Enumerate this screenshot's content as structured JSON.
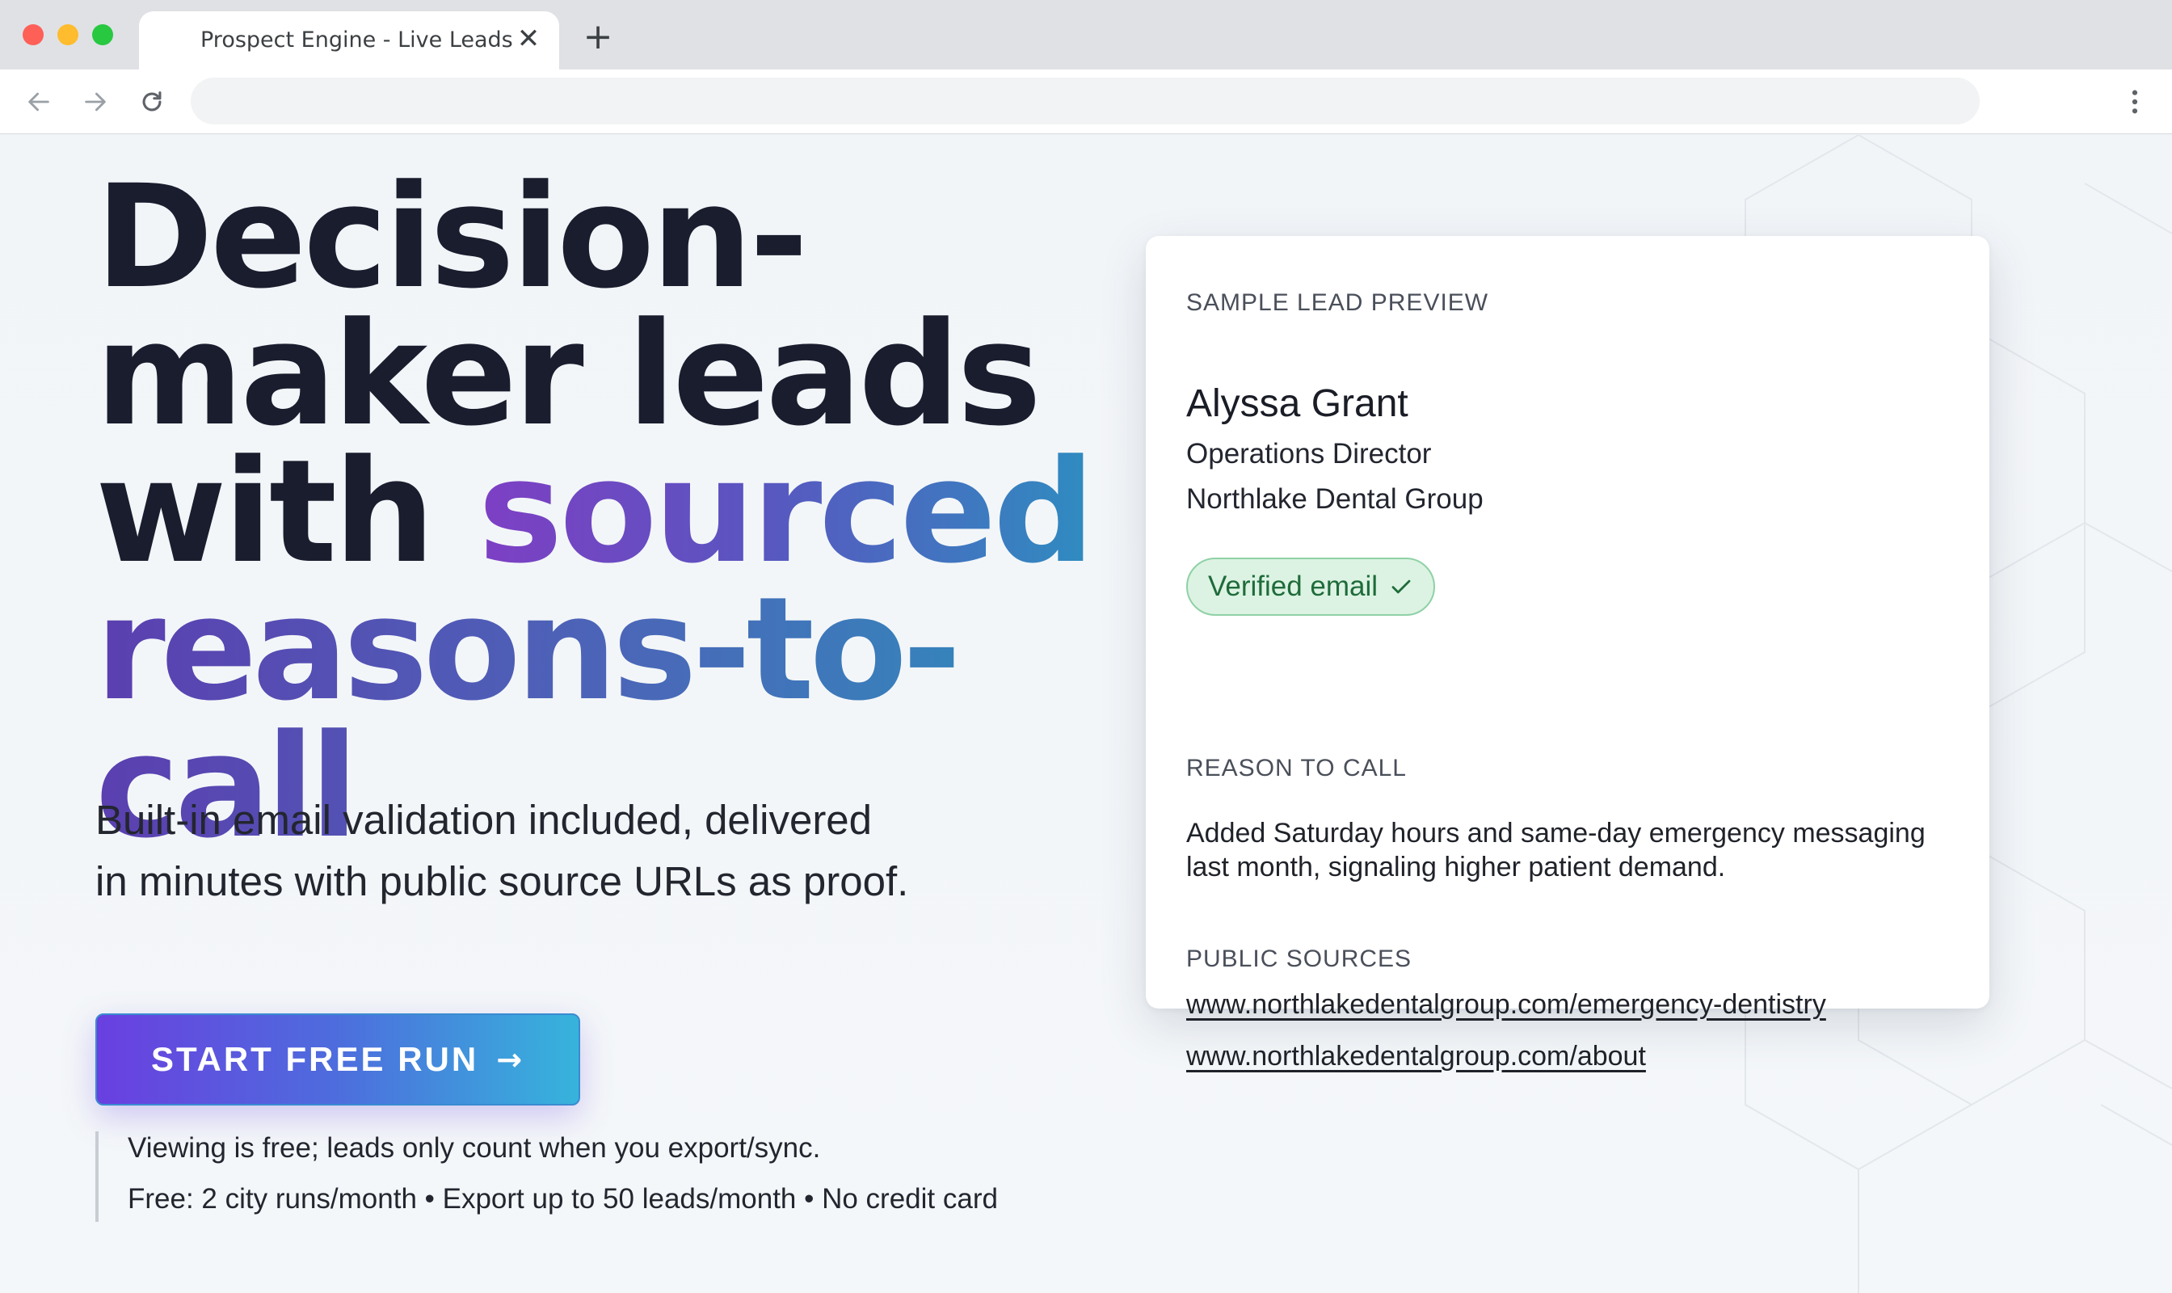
{
  "browser": {
    "tab_title": "Prospect Engine - Live Leads",
    "tab_close": "✕",
    "new_tab": "+",
    "url": ""
  },
  "hero": {
    "headline_line1": "Decision-",
    "headline_line2": "maker leads",
    "headline_line3_a": "with ",
    "headline_line3_b": "sourced",
    "headline_line4": "reasons-to-call",
    "subhead_line1": "Built-in email validation included, delivered",
    "subhead_line2": "in minutes with public source URLs as proof.",
    "cta_label": "START FREE RUN",
    "cta_arrow": "→",
    "note1": "Viewing is free; leads only count when you export/sync.",
    "note2": "Free: 2 city runs/month • Export up to 50 leads/month • No credit card"
  },
  "card": {
    "eyebrow": "SAMPLE LEAD PREVIEW",
    "name": "Alyssa Grant",
    "title": "Operations Director",
    "company": "Northlake Dental Group",
    "badge": "Verified email",
    "reason_label": "REASON TO CALL",
    "reason": "Added Saturday hours and same-day emergency messaging last month, signaling higher patient demand.",
    "sources_label": "PUBLIC SOURCES",
    "sources": [
      "www.northlakedentalgroup.com/emergency-dentistry",
      "www.northlakedentalgroup.com/about"
    ]
  },
  "colors": {
    "headline": "#1a1d2e",
    "gradient_start": "#7e3fc4",
    "gradient_end": "#2f8cc0",
    "cta_start": "#6a3fe0",
    "cta_end": "#36b4dc",
    "badge_bg": "#dcf3e3",
    "badge_text": "#1f6b3a"
  },
  "icons": [
    "back-arrow-icon",
    "forward-arrow-icon",
    "reload-icon",
    "more-vert-icon",
    "checkmark-icon",
    "arrow-right-icon"
  ]
}
